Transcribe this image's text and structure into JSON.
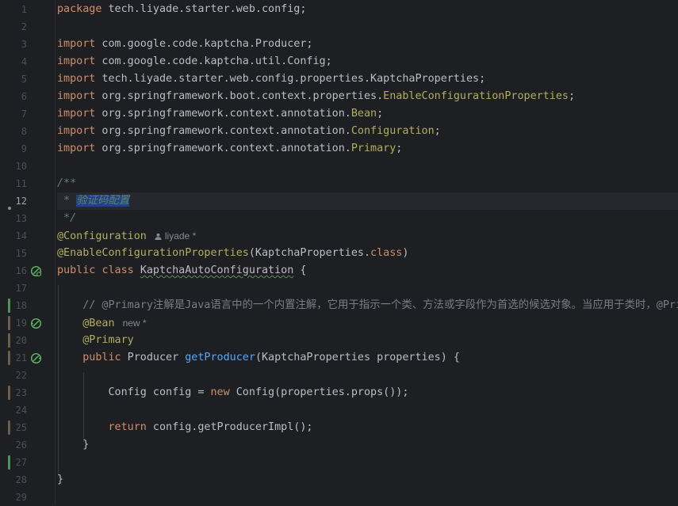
{
  "editor": {
    "language": "Java",
    "current_line": 12,
    "lines": [
      {
        "n": "1"
      },
      {
        "n": "2"
      },
      {
        "n": "3"
      },
      {
        "n": "4"
      },
      {
        "n": "5"
      },
      {
        "n": "6"
      },
      {
        "n": "7"
      },
      {
        "n": "8"
      },
      {
        "n": "9"
      },
      {
        "n": "10"
      },
      {
        "n": "11"
      },
      {
        "n": "12"
      },
      {
        "n": "13"
      },
      {
        "n": "14"
      },
      {
        "n": "15"
      },
      {
        "n": "16"
      },
      {
        "n": "17"
      },
      {
        "n": "18"
      },
      {
        "n": "19"
      },
      {
        "n": "20"
      },
      {
        "n": "21"
      },
      {
        "n": "22"
      },
      {
        "n": "23"
      },
      {
        "n": "24"
      },
      {
        "n": "25"
      },
      {
        "n": "26"
      },
      {
        "n": "27"
      },
      {
        "n": "28"
      },
      {
        "n": "29"
      }
    ],
    "code": {
      "l1_kw": "package",
      "l1_rest": " tech.liyade.starter.web.config;",
      "l3_kw": "import",
      "l3_rest": " com.google.code.kaptcha.Producer;",
      "l4_kw": "import",
      "l4_rest": " com.google.code.kaptcha.util.Config;",
      "l5_kw": "import",
      "l5_rest": " tech.liyade.starter.web.config.properties.KaptchaProperties;",
      "l6_kw": "import",
      "l6_rest": " org.springframework.boot.context.properties.",
      "l6_ann": "EnableConfigurationProperties",
      "l6_end": ";",
      "l7_kw": "import",
      "l7_rest": " org.springframework.context.annotation.",
      "l7_ann": "Bean",
      "l7_end": ";",
      "l8_kw": "import",
      "l8_rest": " org.springframework.context.annotation.",
      "l8_ann": "Configuration",
      "l8_end": ";",
      "l9_kw": "import",
      "l9_rest": " org.springframework.context.annotation.",
      "l9_ann": "Primary",
      "l9_end": ";",
      "l11": "/**",
      "l12_star": " * ",
      "l12_sel": "验证码配置",
      "l13": " */",
      "l14_ann": "@Configuration",
      "l14_hint": "liyade *",
      "l15_ann": "@EnableConfigurationProperties",
      "l15_rest": "(KaptchaProperties.",
      "l15_kw": "class",
      "l15_end": ")",
      "l16_kw1": "public",
      "l16_kw2": "class",
      "l16_name": "KaptchaAutoConfiguration",
      "l16_end": " {",
      "l18": "// @Primary注解是Java语言中的一个内置注解，它用于指示一个类、方法或字段作为首选的候选对象。当应用于类时，@Primary",
      "l19_ann": "@Bean",
      "l19_hint": "new *",
      "l20_ann": "@Primary",
      "l21_kw": "public",
      "l21_type": " Producer ",
      "l21_fn": "getProducer",
      "l21_rest": "(KaptchaProperties properties) {",
      "l23_pre": "Config config = ",
      "l23_kw": "new",
      "l23_rest": " Config(properties.props());",
      "l25_kw": "return",
      "l25_rest": " config.getProducerImpl();",
      "l26": "}",
      "l28": "}"
    }
  },
  "colors": {
    "background": "#1e1f22",
    "keyword": "#cf8e6d",
    "annotation": "#b3ae60",
    "method": "#56a8f5",
    "comment": "#7a7e85",
    "doc_comment": "#5f826b",
    "selection": "#214283"
  },
  "icons": {
    "line_16": "bean-gutter-icon",
    "line_19": "bean-method-gutter-icon",
    "line_21": "bean-method-gutter-icon",
    "hint_user": "user-icon"
  }
}
